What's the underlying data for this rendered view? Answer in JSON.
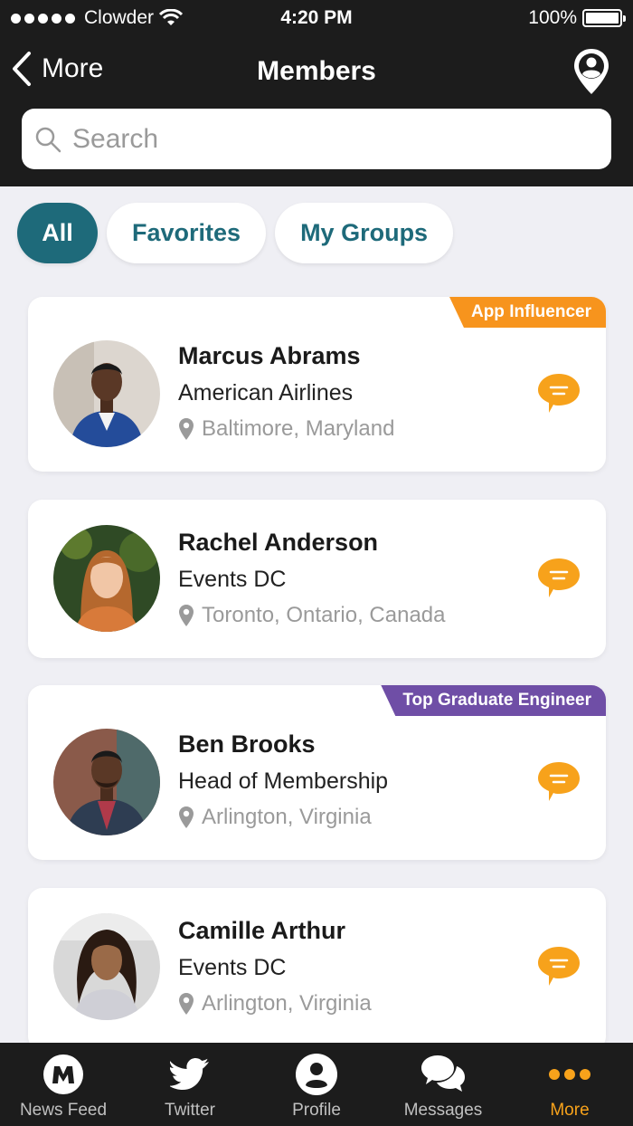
{
  "status_bar": {
    "carrier": "Clowder",
    "time": "4:20 PM",
    "battery": "100%"
  },
  "nav": {
    "back_label": "More",
    "title": "Members"
  },
  "search": {
    "placeholder": "Search"
  },
  "filters": [
    {
      "label": "All",
      "active": true
    },
    {
      "label": "Favorites",
      "active": false
    },
    {
      "label": "My Groups",
      "active": false
    }
  ],
  "members": [
    {
      "name": "Marcus Abrams",
      "org": "American Airlines",
      "location": "Baltimore, Maryland",
      "badge": "App Influencer",
      "badge_color": "#f7941d"
    },
    {
      "name": "Rachel Anderson",
      "org": "Events DC",
      "location": "Toronto, Ontario, Canada",
      "badge": "",
      "badge_color": ""
    },
    {
      "name": "Ben Brooks",
      "org": "Head of Membership",
      "location": "Arlington, Virginia",
      "badge": "Top Graduate Engineer",
      "badge_color": "#6f4ea6"
    },
    {
      "name": "Camille Arthur",
      "org": "Events DC",
      "location": "Arlington, Virginia",
      "badge": "",
      "badge_color": ""
    }
  ],
  "tabbar": [
    {
      "label": "News Feed",
      "icon": "news-feed-icon",
      "active": false
    },
    {
      "label": "Twitter",
      "icon": "twitter-icon",
      "active": false
    },
    {
      "label": "Profile",
      "icon": "profile-icon",
      "active": false
    },
    {
      "label": "Messages",
      "icon": "messages-icon",
      "active": false
    },
    {
      "label": "More",
      "icon": "more-icon",
      "active": true
    }
  ],
  "colors": {
    "accent": "#f7a21b",
    "teal": "#1e6a7a",
    "dark": "#1c1c1c"
  }
}
